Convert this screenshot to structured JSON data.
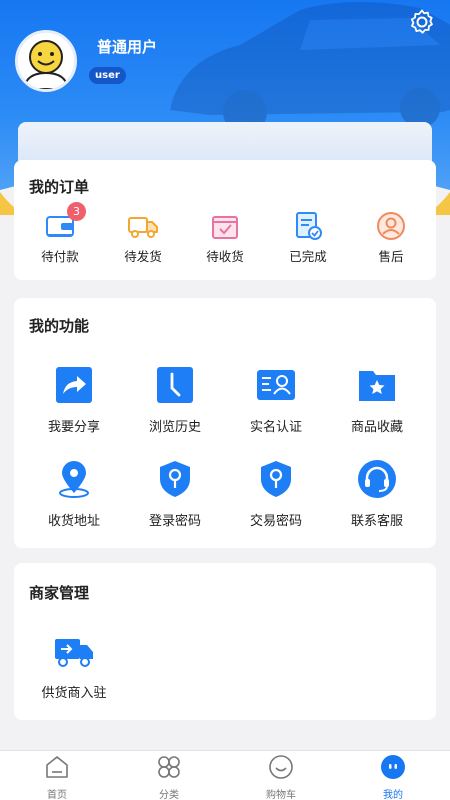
{
  "header": {
    "username": "普通用户",
    "role": "user"
  },
  "orders": {
    "title": "我的订单",
    "items": [
      {
        "label": "待付款",
        "icon": "wallet-icon",
        "badge": "3"
      },
      {
        "label": "待发货",
        "icon": "truck-icon"
      },
      {
        "label": "待收货",
        "icon": "package-check-icon"
      },
      {
        "label": "已完成",
        "icon": "document-check-icon"
      },
      {
        "label": "售后",
        "icon": "customer-service-icon"
      }
    ]
  },
  "functions": {
    "title": "我的功能",
    "items": [
      {
        "label": "我要分享",
        "icon": "share-icon"
      },
      {
        "label": "浏览历史",
        "icon": "history-icon"
      },
      {
        "label": "实名认证",
        "icon": "id-card-icon"
      },
      {
        "label": "商品收藏",
        "icon": "favorite-folder-icon"
      },
      {
        "label": "收货地址",
        "icon": "location-pin-icon"
      },
      {
        "label": "登录密码",
        "icon": "login-shield-icon"
      },
      {
        "label": "交易密码",
        "icon": "trade-shield-icon"
      },
      {
        "label": "联系客服",
        "icon": "headset-icon"
      }
    ]
  },
  "merchant": {
    "title": "商家管理",
    "items": [
      {
        "label": "供货商入驻",
        "icon": "supplier-truck-icon"
      }
    ]
  },
  "tabbar": {
    "items": [
      {
        "label": "首页",
        "icon": "home-icon"
      },
      {
        "label": "分类",
        "icon": "category-icon"
      },
      {
        "label": "购物车",
        "icon": "cart-icon"
      },
      {
        "label": "我的",
        "icon": "profile-icon",
        "active": true
      }
    ]
  },
  "colors": {
    "primary": "#1677f2",
    "badge": "#ef5f6c",
    "background": "#f2f2f4"
  }
}
